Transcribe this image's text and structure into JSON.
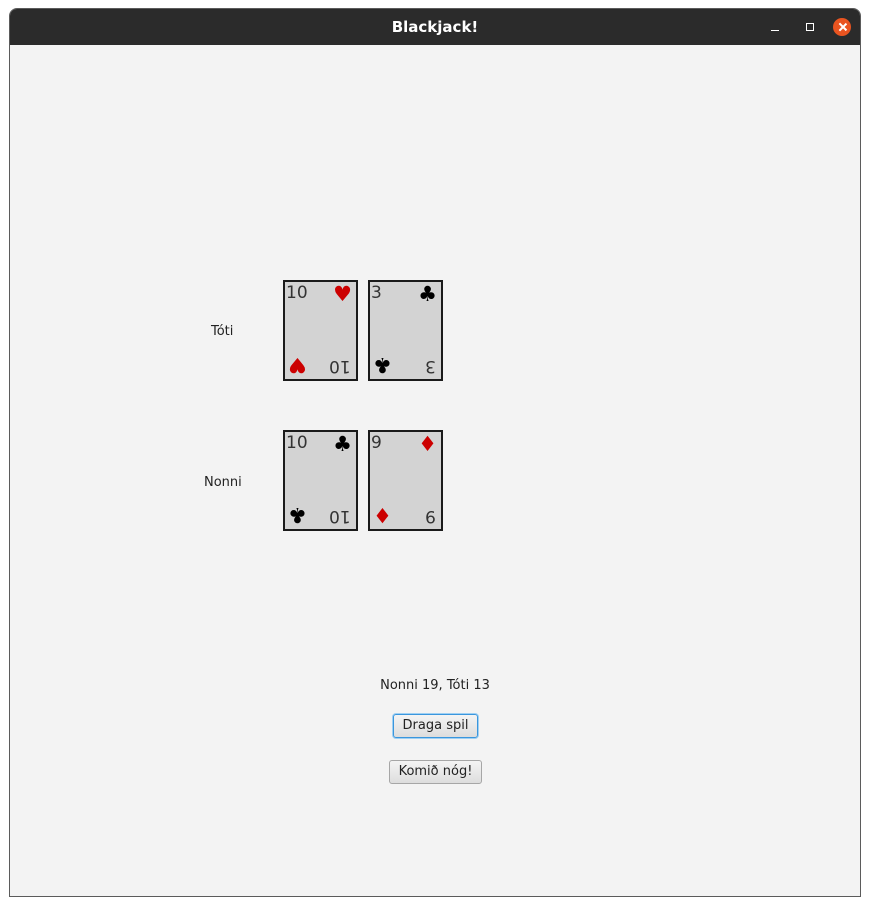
{
  "window": {
    "title": "Blackjack!"
  },
  "players": [
    {
      "name": "Tóti",
      "cards": [
        {
          "rank": "10",
          "suit": "♥",
          "color": "#cc0000"
        },
        {
          "rank": "3",
          "suit": "♣",
          "color": "#000000"
        }
      ]
    },
    {
      "name": "Nonni",
      "cards": [
        {
          "rank": "10",
          "suit": "♣",
          "color": "#000000"
        },
        {
          "rank": "9",
          "suit": "♦",
          "color": "#cc0000"
        }
      ]
    }
  ],
  "status": {
    "score_text": "Nonni 19, Tóti 13"
  },
  "actions": {
    "draw_label": "Draga spil",
    "stand_label": "Komið nóg!"
  }
}
